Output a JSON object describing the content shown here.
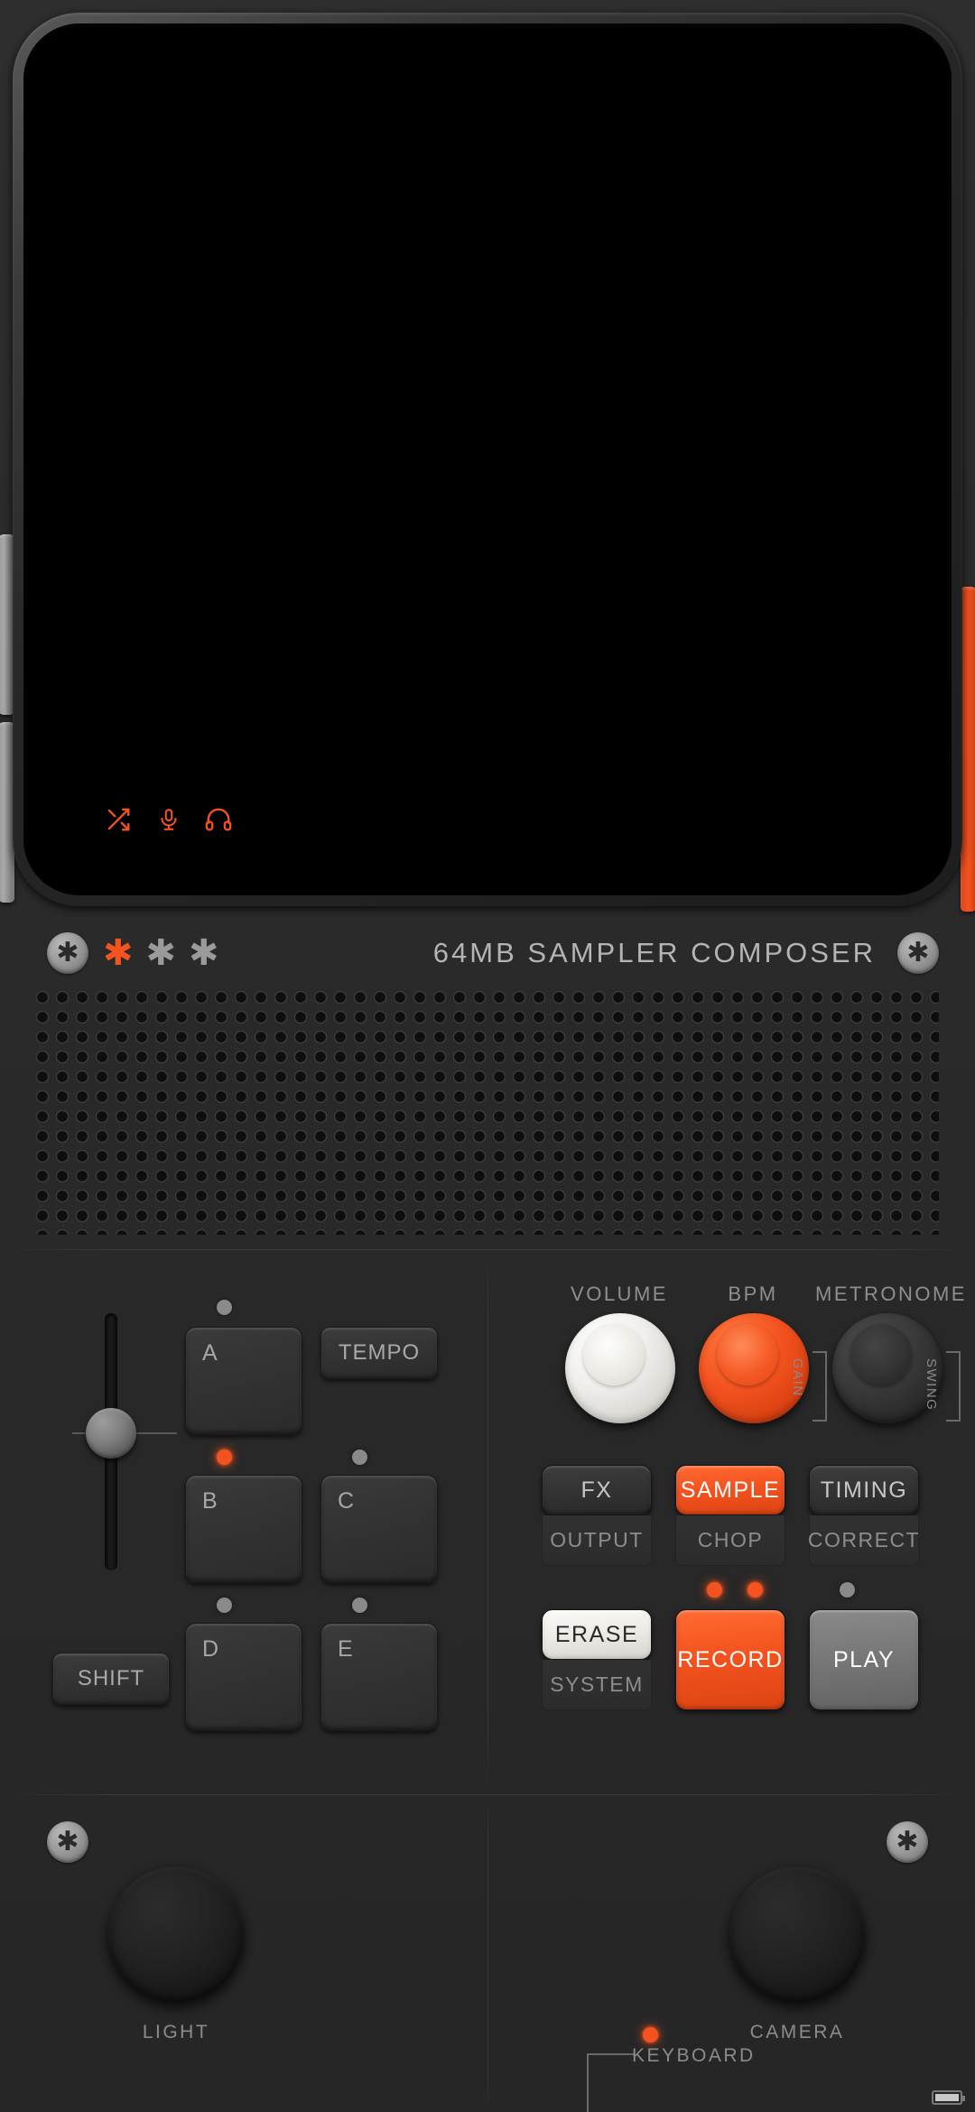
{
  "device": {
    "model_text": "64MB  SAMPLER  COMPOSER",
    "accent_color": "#f4531f",
    "body_color": "#2b2b2b"
  },
  "screen": {
    "status_icons": [
      {
        "name": "shuffle-icon",
        "label": "shuffle"
      },
      {
        "name": "microphone-icon",
        "label": "microphone"
      },
      {
        "name": "headphones-icon",
        "label": "headphones"
      }
    ]
  },
  "label_strip": {
    "screw_glyph": "✱",
    "asterisks": [
      {
        "glyph": "✱",
        "state": "on"
      },
      {
        "glyph": "✱",
        "state": "off"
      },
      {
        "glyph": "✱",
        "state": "off"
      }
    ]
  },
  "left_panel": {
    "fader": {
      "name": "level-fader",
      "value_label": ""
    },
    "pads": [
      {
        "label": "A",
        "led": "off"
      },
      {
        "label": "B",
        "led": "red"
      },
      {
        "label": "C",
        "led": "off"
      },
      {
        "label": "D",
        "led": "off"
      },
      {
        "label": "E",
        "led": "off"
      }
    ],
    "tempo_button": "TEMPO",
    "shift_button": "SHIFT"
  },
  "right_panel": {
    "knobs": [
      {
        "label": "VOLUME",
        "style": "white"
      },
      {
        "label": "BPM",
        "style": "orange"
      },
      {
        "label": "METRONOME",
        "style": "dark"
      }
    ],
    "bracket_labels": [
      {
        "text": "GAIN"
      },
      {
        "text": "SWING"
      }
    ],
    "row1": [
      {
        "button": "FX",
        "style": "dark",
        "sub": "OUTPUT",
        "led": null
      },
      {
        "button": "SAMPLE",
        "style": "orange",
        "sub": "CHOP",
        "led": null
      },
      {
        "button": "TIMING",
        "style": "dark",
        "sub": "CORRECT",
        "led": null
      }
    ],
    "row2": [
      {
        "button": "ERASE",
        "style": "white",
        "sub": "SYSTEM",
        "led": null
      },
      {
        "button": "RECORD",
        "style": "orange",
        "sub": "",
        "led": "red"
      },
      {
        "button": "PLAY",
        "style": "grey",
        "sub": "",
        "led": "off"
      }
    ],
    "record_leds": [
      "red",
      "red"
    ]
  },
  "bottom_panel": {
    "light_label": "LIGHT",
    "camera_label": "CAMERA",
    "keyboard_label": "KEYBOARD",
    "keyboard_led": "red",
    "screw_glyph": "✱"
  }
}
